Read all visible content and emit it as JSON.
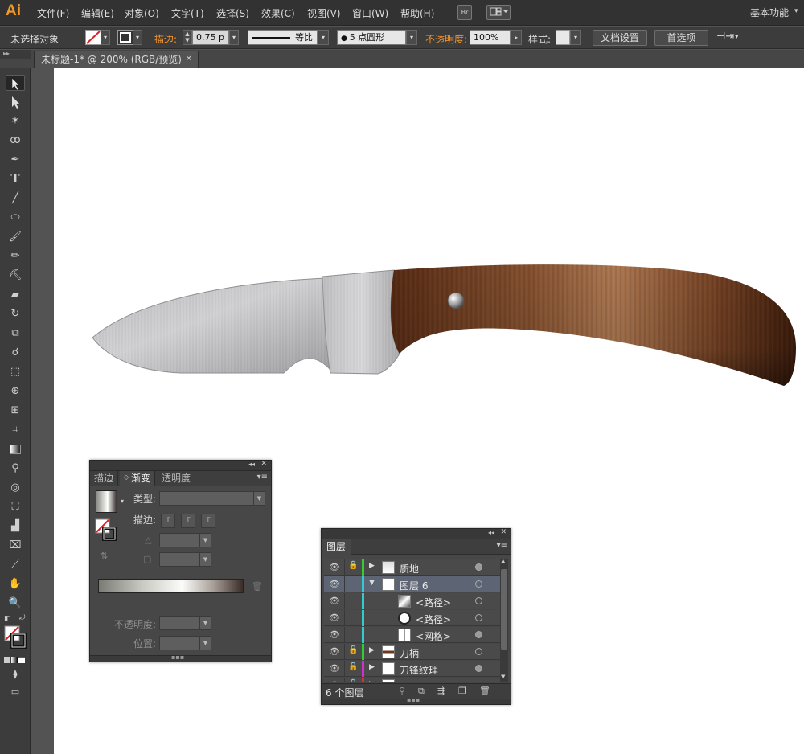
{
  "menubar": {
    "logo": "Ai",
    "items": [
      "文件(F)",
      "编辑(E)",
      "对象(O)",
      "文字(T)",
      "选择(S)",
      "效果(C)",
      "视图(V)",
      "窗口(W)",
      "帮助(H)"
    ],
    "bridge_label": "Br",
    "workspace": "基本功能"
  },
  "control": {
    "selection": "未选择对象",
    "stroke_label": "描边:",
    "stroke_weight": "0.75 p",
    "stroke_profile": "等比",
    "brush": "5 点圆形",
    "opacity_label": "不透明度:",
    "opacity": "100%",
    "style_label": "样式:",
    "doc_setup": "文档设置",
    "preferences": "首选项"
  },
  "document": {
    "tab_title": "未标题-1* @ 200% (RGB/预览)"
  },
  "gradient_panel": {
    "tabs": [
      "描边",
      "渐变",
      "透明度"
    ],
    "active_tab": 1,
    "type_label": "类型:",
    "stroke_label": "描边:",
    "opacity_label": "不透明度:",
    "position_label": "位置:"
  },
  "layers_panel": {
    "title": "图层",
    "layers": [
      {
        "name": "质地",
        "expanded": false,
        "locked": true,
        "color": "#33cc33",
        "thumb": "texture",
        "indent": 0
      },
      {
        "name": "图层 6",
        "expanded": true,
        "locked": false,
        "color": "#33cccc",
        "thumb": "blank",
        "indent": 0,
        "selected": true
      },
      {
        "name": "<路径>",
        "locked": false,
        "color": "#33cccc",
        "thumb": "gradient",
        "indent": 1
      },
      {
        "name": "<路径>",
        "locked": false,
        "color": "#33cccc",
        "thumb": "circle",
        "indent": 1
      },
      {
        "name": "<网格>",
        "locked": false,
        "color": "#33cccc",
        "thumb": "line",
        "indent": 1
      },
      {
        "name": "刀柄",
        "expanded": false,
        "locked": true,
        "color": "#33cc33",
        "thumb": "handle",
        "indent": 0
      },
      {
        "name": "刀锋纹理",
        "expanded": false,
        "locked": true,
        "color": "#cc33cc",
        "thumb": "blank",
        "indent": 0
      },
      {
        "name": "刀锋",
        "expanded": false,
        "locked": true,
        "color": "#cc3333",
        "thumb": "blade",
        "indent": 0
      }
    ],
    "count": "6 个图层"
  }
}
